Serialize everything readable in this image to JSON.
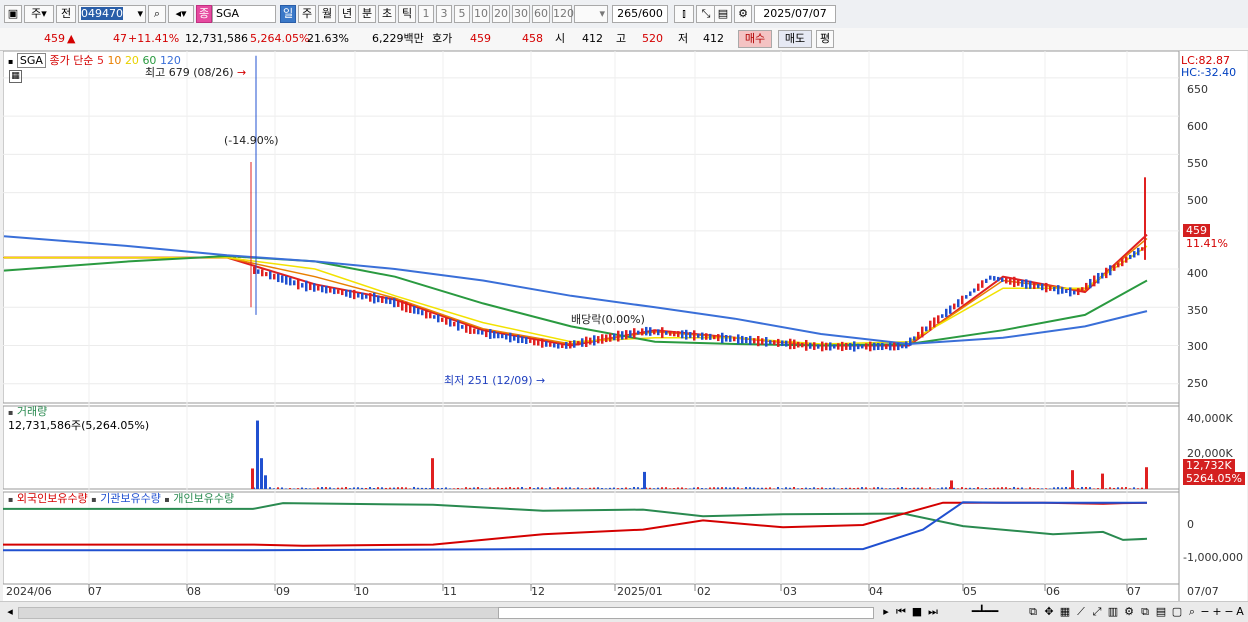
{
  "toolbar": {
    "period_tabs": [
      "주",
      "전"
    ],
    "code_value": "049470",
    "stock_name": "SGA",
    "type_badge": "종",
    "interval_buttons": [
      "일",
      "주",
      "월",
      "년",
      "분",
      "초",
      "틱"
    ],
    "active_interval": "일",
    "minute_buttons": [
      "1",
      "3",
      "5",
      "10",
      "20",
      "30",
      "60",
      "120"
    ],
    "count": "265",
    "count_max": "/600",
    "date": "2025/07/07"
  },
  "infobar": {
    "price": "459",
    "arrow": "▲",
    "change": "47",
    "change_pct": "+11.41%",
    "volume": "12,731,586",
    "volume_pct": "5,264.05%",
    "turnover": "21.63%",
    "amount": "6,229백만",
    "quote_label": "호가",
    "ask": "459",
    "bid": "458",
    "open_label": "시",
    "open": "412",
    "high_label": "고",
    "high": "520",
    "low_label": "저",
    "low": "412",
    "buy_label": "매수",
    "sell_label": "매도",
    "eval_label": "평"
  },
  "price_panel": {
    "legend_name": "SGA",
    "legend_type": "종가 단순",
    "ma": [
      {
        "period": "5",
        "color": "#e02020"
      },
      {
        "period": "10",
        "color": "#e87f00"
      },
      {
        "period": "20",
        "color": "#f2e200"
      },
      {
        "period": "60",
        "color": "#2a9a40"
      },
      {
        "period": "120",
        "color": "#3a6fd8"
      }
    ],
    "high_note": "최고 679 (08/26)",
    "low_note": "최저 251 (12/09)",
    "pct_note": "(-14.90%)",
    "dividend_note": "배당락(0.00%)",
    "lc": "LC:82.87",
    "hc": "HC:-32.40",
    "current_price": "459",
    "current_pct": "11.41%",
    "y_ticks": [
      "650",
      "600",
      "550",
      "500",
      "450",
      "400",
      "350",
      "300",
      "250"
    ]
  },
  "volume_panel": {
    "title": "거래량",
    "value": "12,731,586주(5,264.05%)",
    "y_ticks": [
      "40,000K",
      "20,000K"
    ],
    "current": "12,732K",
    "current_pct": "5264.05%"
  },
  "holdings_panel": {
    "legend": [
      {
        "name": "외국인보유수량",
        "color": "#d40000"
      },
      {
        "name": "기관보유수량",
        "color": "#2050d0"
      },
      {
        "name": "개인보유수량",
        "color": "#2a8a50"
      }
    ],
    "y_ticks": [
      "0",
      "-1,000,000"
    ]
  },
  "x_axis": {
    "labels": [
      "2024/06",
      "07",
      "08",
      "09",
      "10",
      "11",
      "12",
      "2025/01",
      "02",
      "03",
      "04",
      "05",
      "06",
      "07"
    ],
    "right_label": "07/07"
  },
  "chart_data": {
    "type": "line",
    "title": "",
    "x": [
      "2024/06",
      "2024/07",
      "2024/08",
      "2024/09",
      "2024/10",
      "2024/11",
      "2024/12",
      "2025/01",
      "2025/02",
      "2025/03",
      "2025/04",
      "2025/05",
      "2025/06",
      "2025/07"
    ],
    "ylim": [
      230,
      680
    ],
    "series": [
      {
        "name": "5",
        "values": [
          415,
          415,
          415,
          380,
          360,
          320,
          300,
          320,
          310,
          300,
          300,
          390,
          370,
          445
        ]
      },
      {
        "name": "10",
        "values": [
          415,
          415,
          415,
          390,
          362,
          322,
          302,
          318,
          310,
          300,
          302,
          385,
          372,
          440
        ]
      },
      {
        "name": "20",
        "values": [
          415,
          415,
          415,
          400,
          365,
          330,
          305,
          310,
          310,
          302,
          305,
          375,
          375,
          430
        ]
      },
      {
        "name": "60",
        "values": [
          398,
          410,
          417,
          410,
          390,
          355,
          325,
          305,
          302,
          300,
          302,
          320,
          340,
          385
        ]
      },
      {
        "name": "120",
        "values": [
          443,
          430,
          418,
          410,
          400,
          385,
          365,
          350,
          335,
          315,
          302,
          310,
          325,
          345
        ]
      }
    ],
    "volume": {
      "ylim": [
        0,
        45000
      ],
      "unit": "K"
    }
  }
}
